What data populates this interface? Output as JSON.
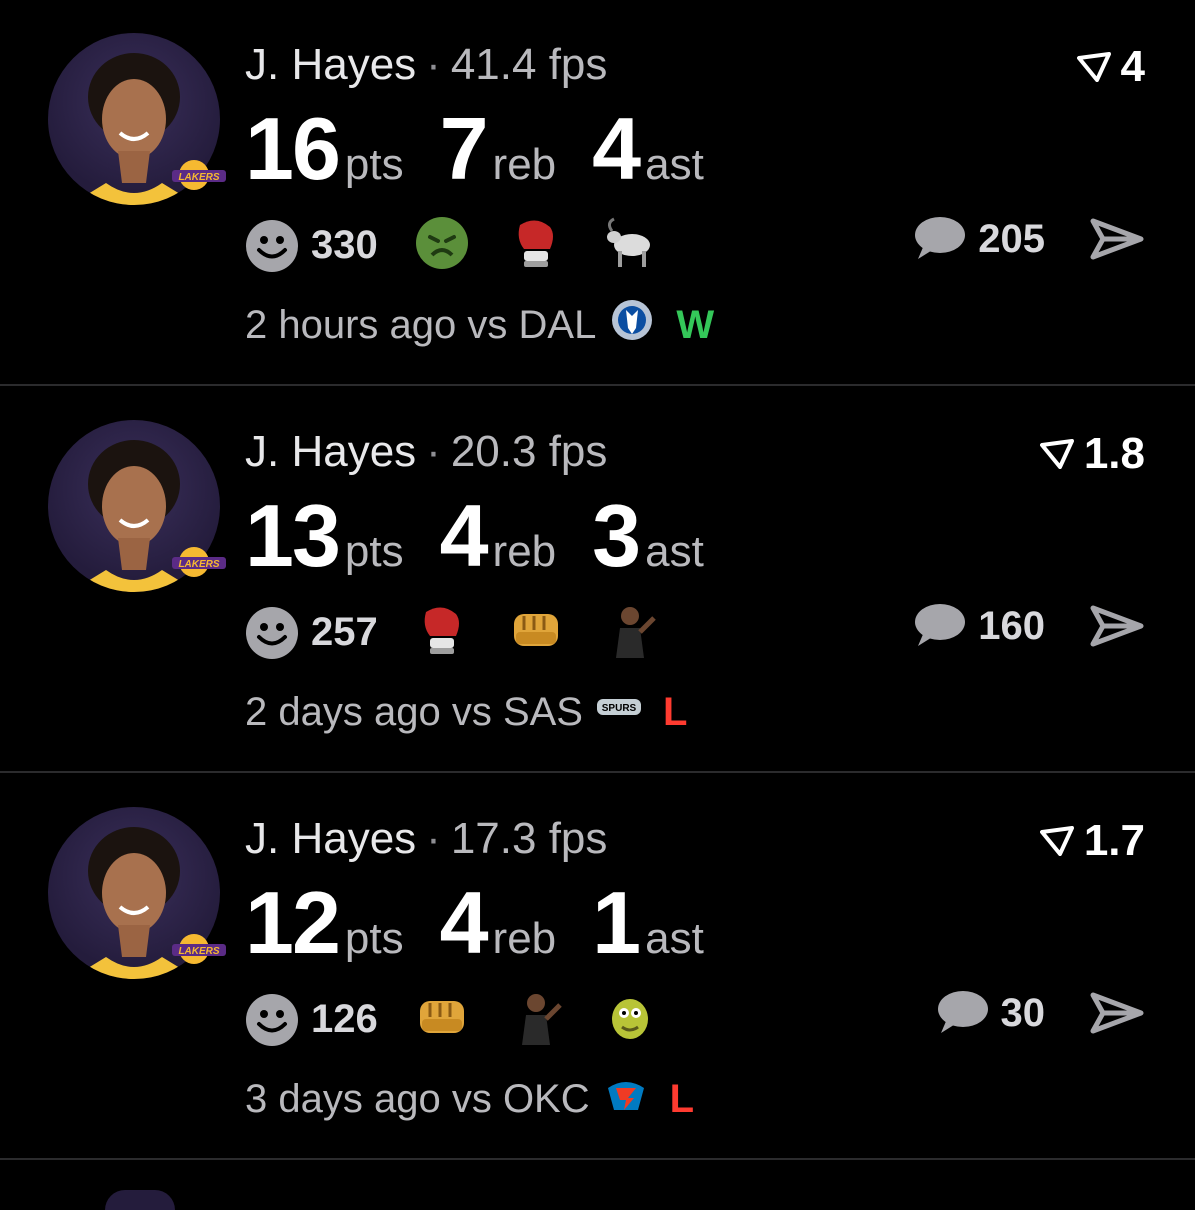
{
  "colors": {
    "background": "#000000",
    "win": "#34c759",
    "loss": "#ff3b30",
    "muted": "#b9b9bd"
  },
  "cards": [
    {
      "player": "J. Hayes",
      "separator": "·",
      "fps": "41.4 fps",
      "score": "4",
      "stats": [
        {
          "value": "16",
          "unit": "pts"
        },
        {
          "value": "7",
          "unit": "reb"
        },
        {
          "value": "4",
          "unit": "ast"
        }
      ],
      "reaction_count": "330",
      "reactions": [
        "nauseated-face-emoji",
        "boxing-glove-emoji",
        "goat-emoji"
      ],
      "comment_count": "205",
      "time": "2 hours ago",
      "vs": "vs DAL",
      "opponent_logo": "mavericks-logo",
      "result": "W"
    },
    {
      "player": "J. Hayes",
      "separator": "·",
      "fps": "20.3 fps",
      "score": "1.8",
      "stats": [
        {
          "value": "13",
          "unit": "pts"
        },
        {
          "value": "4",
          "unit": "reb"
        },
        {
          "value": "3",
          "unit": "ast"
        }
      ],
      "reaction_count": "257",
      "reactions": [
        "boxing-glove-emoji",
        "fist-bump-emoji",
        "player-sticker"
      ],
      "comment_count": "160",
      "time": "2 days ago",
      "vs": "vs SAS",
      "opponent_logo": "spurs-logo",
      "result": "L"
    },
    {
      "player": "J. Hayes",
      "separator": "·",
      "fps": "17.3 fps",
      "score": "1.7",
      "stats": [
        {
          "value": "12",
          "unit": "pts"
        },
        {
          "value": "4",
          "unit": "reb"
        },
        {
          "value": "1",
          "unit": "ast"
        }
      ],
      "reaction_count": "126",
      "reactions": [
        "fist-bump-emoji",
        "player-sticker",
        "sponge-sticker"
      ],
      "comment_count": "30",
      "time": "3 days ago",
      "vs": "vs OKC",
      "opponent_logo": "thunder-logo",
      "result": "L"
    }
  ]
}
